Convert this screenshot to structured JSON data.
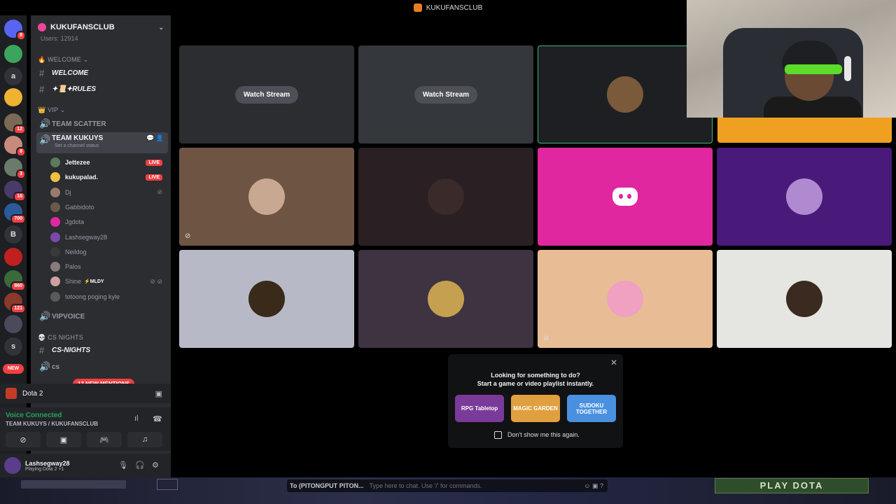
{
  "window": {
    "title": "KUKUFANSCLUB"
  },
  "servers": [
    {
      "label": "",
      "badge": "8",
      "color": "#5865f2"
    },
    {
      "label": "",
      "badge": "",
      "color": "#3ba55d"
    },
    {
      "label": "a",
      "badge": "",
      "color": "#313338"
    },
    {
      "label": "",
      "badge": "",
      "color": "#f0b232"
    },
    {
      "label": "",
      "badge": "12",
      "color": "#7a6a55"
    },
    {
      "label": "",
      "badge": "8",
      "color": "#c88a7a"
    },
    {
      "label": "",
      "badge": "3",
      "color": "#6b7a6a"
    },
    {
      "label": "",
      "badge": "16",
      "color": "#4a3a6a"
    },
    {
      "label": "",
      "badge": "700",
      "color": "#2a5a9a"
    },
    {
      "label": "B",
      "badge": "",
      "color": "#313338"
    },
    {
      "label": "",
      "badge": "",
      "color": "#c02020"
    },
    {
      "label": "",
      "badge": "860",
      "color": "#3a6a3a"
    },
    {
      "label": "",
      "badge": "121",
      "color": "#8a3a2a"
    },
    {
      "label": "",
      "badge": "",
      "color": "#4a4a5a"
    },
    {
      "label": "s",
      "badge": "",
      "color": "#313338"
    }
  ],
  "new_pill": "NEW",
  "guild": {
    "name": "KUKUFANSCLUB",
    "users": "Users: 12914"
  },
  "categories": {
    "welcome": "WELCOME",
    "vip": "VIP",
    "cs_nights": "CS NIGHTS"
  },
  "channels": {
    "welcome": "WELCOME",
    "rules": "✦📜✦RULES",
    "team_scatter": "TEAM SCATTER",
    "team_kukuys": "TEAM KUKUYS",
    "team_kukuys_status": "Set a channel status",
    "vipvoice": "VIPVOICE",
    "cs_nights": "CS-NIGHTS",
    "cs_partial": "cs"
  },
  "voice_users": [
    {
      "name": "Jettezee",
      "live": true,
      "bright": true,
      "muted": false,
      "color": "#5c7a5c"
    },
    {
      "name": "kukupalad.",
      "live": true,
      "bright": true,
      "muted": false,
      "color": "#f0c040"
    },
    {
      "name": "Dj",
      "live": false,
      "bright": false,
      "muted": true,
      "color": "#9a7a6a"
    },
    {
      "name": "Gabbidoto",
      "live": false,
      "bright": false,
      "muted": false,
      "color": "#6a5a4a"
    },
    {
      "name": "Jgdota",
      "live": false,
      "bright": false,
      "muted": false,
      "color": "#e0279f"
    },
    {
      "name": "Lashsegway28",
      "live": false,
      "bright": false,
      "muted": false,
      "color": "#7a4aaa"
    },
    {
      "name": "Neildog",
      "live": false,
      "bright": false,
      "muted": false,
      "color": "#3a3a3a"
    },
    {
      "name": "Palos",
      "live": false,
      "bright": false,
      "muted": false,
      "color": "#8a7a7a"
    },
    {
      "name": "Shine",
      "live": false,
      "bright": false,
      "muted": true,
      "color": "#d0a0a0"
    },
    {
      "name": "totoong poging kyle",
      "live": false,
      "bright": false,
      "muted": false,
      "color": "#5a5a5a"
    }
  ],
  "live_label": "LIVE",
  "shine_tag": "⚡MLDY",
  "mentions": "13 NEW MENTIONS",
  "activity": {
    "game": "Dota 2"
  },
  "voice_connection": {
    "title": "Voice Connected",
    "channel": "TEAM KUKUYS / KUKUFANSCLUB"
  },
  "user": {
    "name": "Lashsegway28",
    "status": "Playing Dota 2 +1"
  },
  "tiles": [
    {
      "kind": "stream",
      "bg": "#2b2d31",
      "label": "Watch Stream"
    },
    {
      "kind": "stream",
      "bg": "#34373c",
      "label": "Watch Stream"
    },
    {
      "kind": "avatar",
      "bg": "#1e1f22",
      "av": "#7a5a3a",
      "border": "#43b581"
    },
    {
      "kind": "blank",
      "bg": "#000000"
    },
    {
      "kind": "avatar",
      "bg": "#6e5543",
      "av": "#c8a890",
      "icon": "mute-icon"
    },
    {
      "kind": "avatar",
      "bg": "#2a1f22",
      "av": "#3a2a2a"
    },
    {
      "kind": "discord",
      "bg": "#e0279f"
    },
    {
      "kind": "avatar",
      "bg": "#4a1a7a",
      "av": "#b08ad0"
    },
    {
      "kind": "avatar",
      "bg": "#b7b9c7",
      "av": "#3a2a1a"
    },
    {
      "kind": "avatar",
      "bg": "#3e3340",
      "av": "#c4a050"
    },
    {
      "kind": "avatar",
      "bg": "#e8bd95",
      "av": "#f0a0c0",
      "icon": "video-off-icon"
    },
    {
      "kind": "avatar",
      "bg": "#e5e6e1",
      "av": "#3a2a20"
    }
  ],
  "popup": {
    "line1": "Looking for something to do?",
    "line2": "Start a game or video playlist instantly.",
    "activities": [
      {
        "name": "RPG Tabletop",
        "color": "#7a3a9a"
      },
      {
        "name": "MAGIC GARDEN",
        "color": "#e0a040"
      },
      {
        "name": "SUDOKU TOGETHER",
        "color": "#4a90e0"
      }
    ],
    "checkbox_label": "Don't show me this again."
  },
  "game_bar": {
    "chat_target": "To (PITONGPUT PITON...",
    "chat_placeholder": "Type here to chat. Use '/' for commands.",
    "play_button": "PLAY DOTA"
  }
}
